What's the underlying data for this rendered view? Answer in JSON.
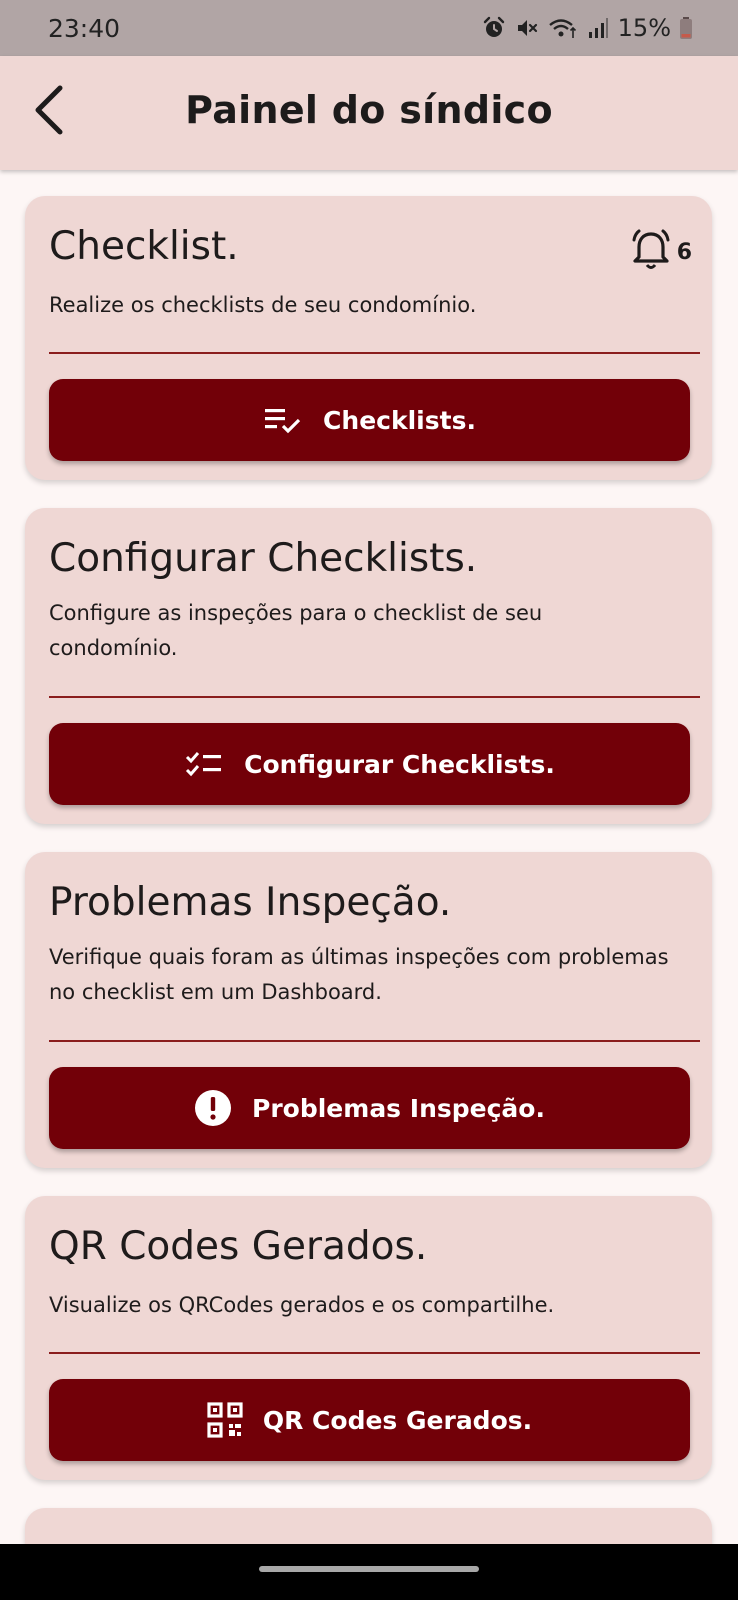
{
  "status_bar": {
    "time": "23:40",
    "battery": "15%",
    "icons": [
      "alarm-icon",
      "mute-icon",
      "wifi-icon",
      "signal-icon",
      "battery-icon"
    ]
  },
  "app_bar": {
    "title": "Painel do síndico",
    "back_icon": "arrow-back-icon"
  },
  "cards": [
    {
      "title": "Checklist.",
      "description": "Realize os checklists de seu condomínio.",
      "button_label": "Checklists.",
      "button_icon": "playlist-check-icon",
      "badge_icon": "bell-icon",
      "badge_count": "6"
    },
    {
      "title": "Configurar Checklists.",
      "description": "Configure as inspeções para o checklist de seu condomínio.",
      "button_label": "Configurar Checklists.",
      "button_icon": "checklist-icon"
    },
    {
      "title": "Problemas Inspeção.",
      "description": "Verifique quais foram as últimas inspeções com problemas no checklist em um Dashboard.",
      "button_label": "Problemas Inspeção.",
      "button_icon": "error-circle-icon"
    },
    {
      "title": "QR Codes Gerados.",
      "description": "Visualize os QRCodes gerados e os compartilhe.",
      "button_label": "QR Codes Gerados.",
      "button_icon": "qr-code-icon"
    }
  ],
  "colors": {
    "background": "#fdf6f5",
    "card": "#efd7d4",
    "app_bar": "#efd7d4",
    "button": "#720008",
    "divider": "#8a1d1d",
    "status_bar": "#b1a5a5"
  }
}
